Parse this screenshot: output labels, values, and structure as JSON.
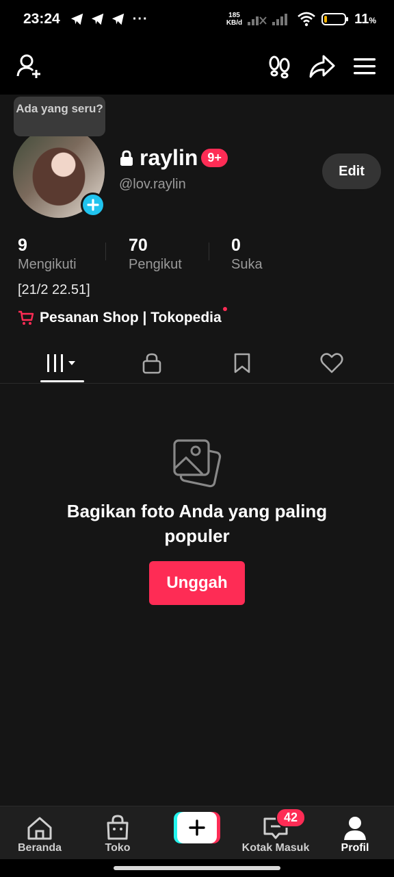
{
  "status_bar": {
    "time": "23:24",
    "notification_icons": [
      "telegram-icon",
      "telegram-icon",
      "telegram-icon"
    ],
    "more": "···",
    "net_speed_value": "185",
    "net_speed_unit": "KB/d",
    "battery_percent": "11",
    "battery_unit": "%"
  },
  "topbar": {
    "icons": [
      "add-friend-icon",
      "footprints-icon",
      "share-icon",
      "menu-icon"
    ]
  },
  "tooltip": {
    "text": "Ada yang seru?"
  },
  "profile": {
    "username": "raylin",
    "badge": "9+",
    "handle": "@lov.raylin",
    "edit_label": "Edit"
  },
  "stats": [
    {
      "value": "9",
      "label": "Mengikuti"
    },
    {
      "value": "70",
      "label": "Pengikut"
    },
    {
      "value": "0",
      "label": "Suka"
    }
  ],
  "bio": "[21/2 22.51]",
  "shop_link": "Pesanan Shop | Tokopedia",
  "tabs": [
    "videos-grid-icon",
    "lock-icon",
    "bookmark-icon",
    "heart-icon"
  ],
  "empty_state": {
    "text": "Bagikan foto Anda yang paling populer",
    "button": "Unggah"
  },
  "bottom_nav": {
    "items": [
      {
        "label": "Beranda",
        "icon": "home-icon"
      },
      {
        "label": "Toko",
        "icon": "shop-bag-icon"
      },
      {
        "label": "",
        "icon": "create-plus-icon"
      },
      {
        "label": "Kotak Masuk",
        "icon": "inbox-icon"
      },
      {
        "label": "Profil",
        "icon": "profile-icon"
      }
    ],
    "inbox_badge": "42",
    "active": "Profil"
  },
  "colors": {
    "accent": "#fe2c55",
    "cyan": "#25f4ee",
    "background": "#151515"
  }
}
